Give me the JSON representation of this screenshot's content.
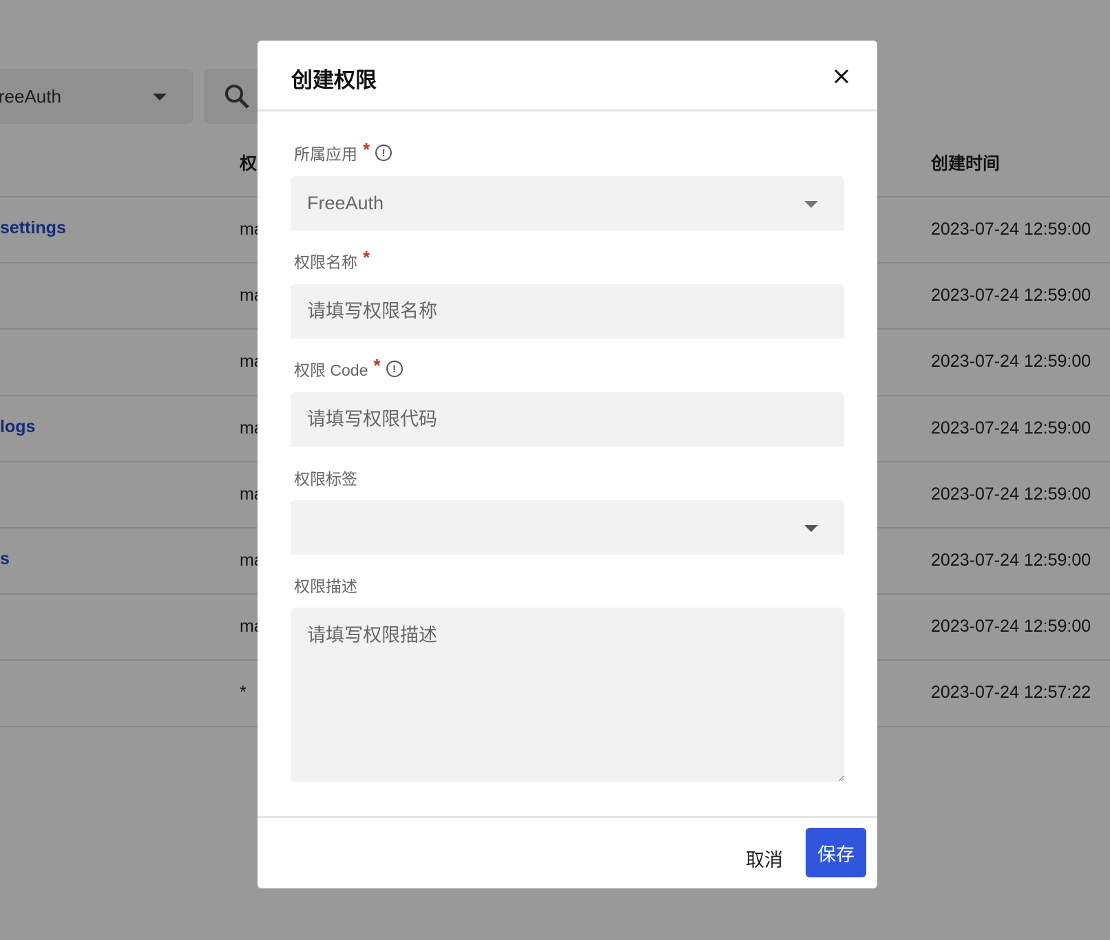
{
  "background": {
    "app_select_value": "FreeAuth",
    "columns": {
      "code": "权",
      "created": "创建时间"
    },
    "rows": [
      {
        "name": "settings",
        "code": "ma",
        "created": "2023-07-24 12:59:00"
      },
      {
        "name": "",
        "code": "ma",
        "created": "2023-07-24 12:59:00"
      },
      {
        "name": "",
        "code": "ma",
        "created": "2023-07-24 12:59:00"
      },
      {
        "name": "logs",
        "code": "ma",
        "created": "2023-07-24 12:59:00"
      },
      {
        "name": "",
        "code": "ma",
        "created": "2023-07-24 12:59:00"
      },
      {
        "name": "s",
        "code": "ma",
        "created": "2023-07-24 12:59:00"
      },
      {
        "name": "",
        "code": "ma",
        "created": "2023-07-24 12:59:00"
      },
      {
        "name": "",
        "code": "*",
        "created": "2023-07-24 12:57:22"
      }
    ]
  },
  "modal": {
    "title": "创建权限",
    "fields": {
      "app": {
        "label": "所属应用",
        "required": "*",
        "value": "FreeAuth"
      },
      "name": {
        "label": "权限名称",
        "required": "*",
        "placeholder": "请填写权限名称"
      },
      "code": {
        "label": "权限 Code",
        "required": "*",
        "placeholder": "请填写权限代码"
      },
      "tags": {
        "label": "权限标签",
        "value": ""
      },
      "description": {
        "label": "权限描述",
        "placeholder": "请填写权限描述"
      }
    },
    "cancel_label": "取消",
    "save_label": "保存"
  },
  "colors": {
    "primary": "#2f56db",
    "link": "#2548c9",
    "required": "#c0392b"
  }
}
